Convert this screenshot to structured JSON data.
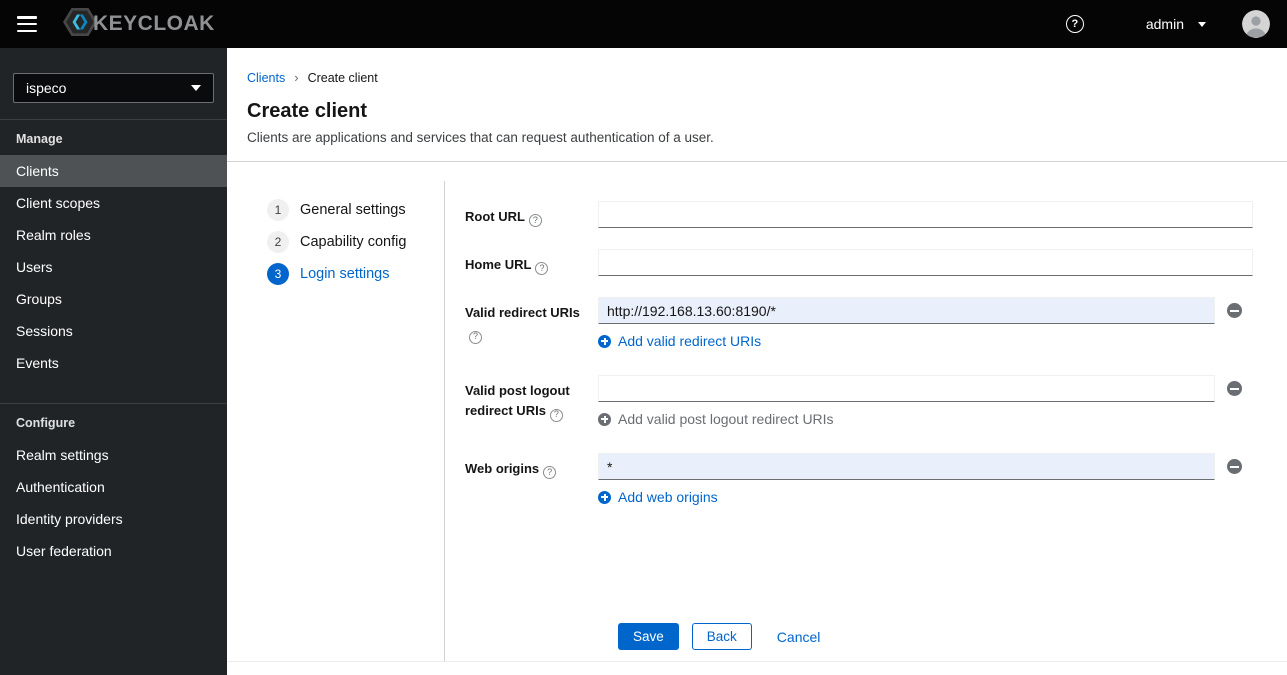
{
  "topbar": {
    "brand_text": "KEYCLOAK",
    "username": "admin"
  },
  "sidebar": {
    "realm": "ispeco",
    "sections": [
      {
        "label": "Manage",
        "items": [
          {
            "label": "Clients",
            "active": true
          },
          {
            "label": "Client scopes",
            "active": false
          },
          {
            "label": "Realm roles",
            "active": false
          },
          {
            "label": "Users",
            "active": false
          },
          {
            "label": "Groups",
            "active": false
          },
          {
            "label": "Sessions",
            "active": false
          },
          {
            "label": "Events",
            "active": false
          }
        ]
      },
      {
        "label": "Configure",
        "items": [
          {
            "label": "Realm settings",
            "active": false
          },
          {
            "label": "Authentication",
            "active": false
          },
          {
            "label": "Identity providers",
            "active": false
          },
          {
            "label": "User federation",
            "active": false
          }
        ]
      }
    ]
  },
  "breadcrumb": {
    "parent": "Clients",
    "current": "Create client"
  },
  "page": {
    "title": "Create client",
    "subtitle": "Clients are applications and services that can request authentication of a user."
  },
  "wizard": {
    "steps": [
      {
        "number": "1",
        "label": "General settings",
        "active": false
      },
      {
        "number": "2",
        "label": "Capability config",
        "active": false
      },
      {
        "number": "3",
        "label": "Login settings",
        "active": true
      }
    ]
  },
  "form": {
    "root_url": {
      "label": "Root URL",
      "value": ""
    },
    "home_url": {
      "label": "Home URL",
      "value": ""
    },
    "redirect_uris": {
      "label": "Valid redirect URIs",
      "value": "http://192.168.13.60:8190/*",
      "add_label": "Add valid redirect URIs"
    },
    "post_logout": {
      "label": "Valid post logout redirect URIs",
      "value": "",
      "add_label": "Add valid post logout redirect URIs"
    },
    "web_origins": {
      "label": "Web origins",
      "value": "*",
      "add_label": "Add web origins"
    },
    "actions": {
      "save": "Save",
      "back": "Back",
      "cancel": "Cancel"
    }
  },
  "colors": {
    "primary_blue": "#0066cc",
    "topbar_bg": "#050505",
    "sidebar_bg": "#212427",
    "sidebar_active_bg": "#4f5255",
    "filled_input_bg": "#e9f0fb",
    "divider": "#d2d2d2",
    "icon_gray": "#6a6e73"
  }
}
